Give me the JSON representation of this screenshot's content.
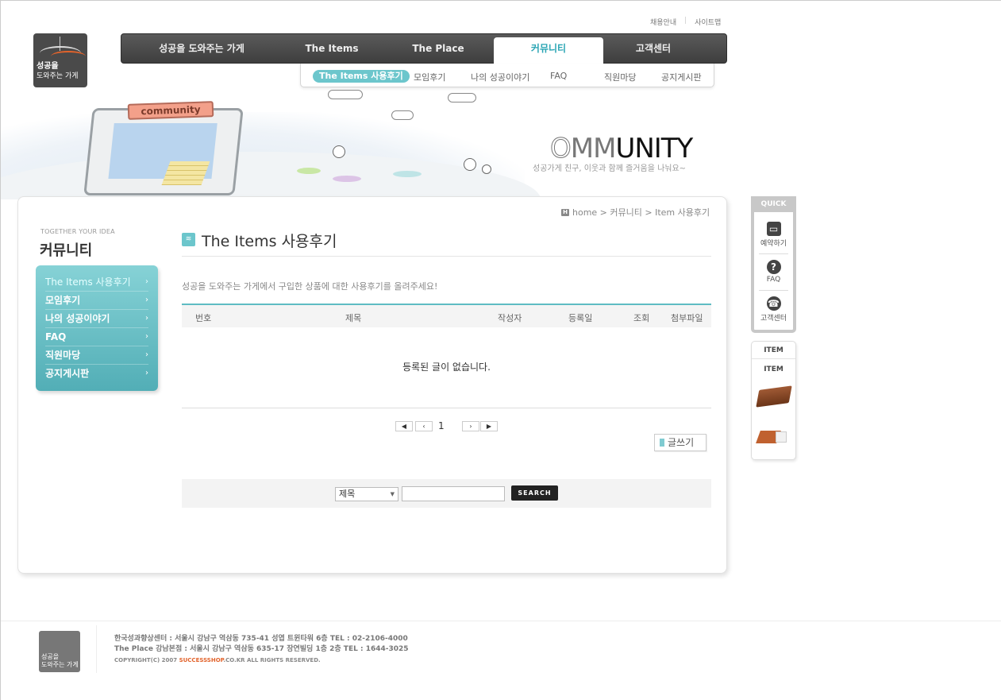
{
  "util_links": [
    "채용안내",
    "사이트맵"
  ],
  "logo": {
    "line1": "성공을",
    "line2": "도와주는 가게"
  },
  "gnb": [
    {
      "label": "성공을 도와주는 가게"
    },
    {
      "label": "The Items"
    },
    {
      "label": "The Place"
    },
    {
      "label": "커뮤니티",
      "active": true
    },
    {
      "label": "고객센터"
    }
  ],
  "lnb": [
    "The Items 사용후기",
    "모임후기",
    "나의 성공이야기",
    "FAQ",
    "직원마당",
    "공지게시판"
  ],
  "banner": {
    "sign": "community",
    "heading_light": "O",
    "heading_mid": "MM",
    "heading_dark": "UNITY",
    "slogan": "성공가게 친구, 이웃과 함께 즐거움을 나눠요~"
  },
  "sidebar": {
    "subtitle": "TOGETHER YOUR IDEA",
    "title": "커뮤니티",
    "items": [
      "The Items 사용후기",
      "모임후기",
      "나의 성공이야기",
      "FAQ",
      "직원마당",
      "공지게시판"
    ]
  },
  "location": {
    "home_badge": "H",
    "path": "home > 커뮤니티 > Item 사용후기"
  },
  "page": {
    "title": "The Items 사용후기",
    "description": "성공을 도와주는 가게에서 구입한 상품에 대한 사용후기를 올려주세요!"
  },
  "table": {
    "columns": [
      "번호",
      "제목",
      "작성자",
      "등록일",
      "조회",
      "첨부파일"
    ],
    "empty_message": "등록된 글이 없습니다."
  },
  "pagination": {
    "current": "1",
    "first": "◀",
    "prev": "‹",
    "next": "›",
    "last": "▶"
  },
  "write_button": "글쓰기",
  "search": {
    "field_selected": "제목",
    "button": "SEARCH",
    "query": ""
  },
  "quick": {
    "header": "QUICK",
    "items": [
      {
        "label": "예약하기",
        "icon": "monitor-icon"
      },
      {
        "label": "FAQ",
        "icon": "question-icon"
      },
      {
        "label": "고객센터",
        "icon": "telephone-icon"
      }
    ]
  },
  "item_box": {
    "header": "ITEM",
    "sub": "ITEM"
  },
  "footer": {
    "line1": "한국성과향상센터 : 서울시 강남구 역삼동 735-41 성엽 트윈타워 6층 TEL : 02-2106-4000",
    "line2": "The Place 강남본점 : 서울시 강남구 역삼동 635-17 장연빌딩 1층 2층 TEL : 1644-3025",
    "copy_prefix": "COPYRIGHT(C) 2007 ",
    "copy_brand": "SUCCESSSHOP",
    "copy_suffix": ".CO.KR   ALL RIGHTS RESERVED."
  },
  "colors": {
    "accent": "#5fbcc3",
    "nav_dark": "#3e3e3e",
    "brand_orange": "#e2632b"
  }
}
